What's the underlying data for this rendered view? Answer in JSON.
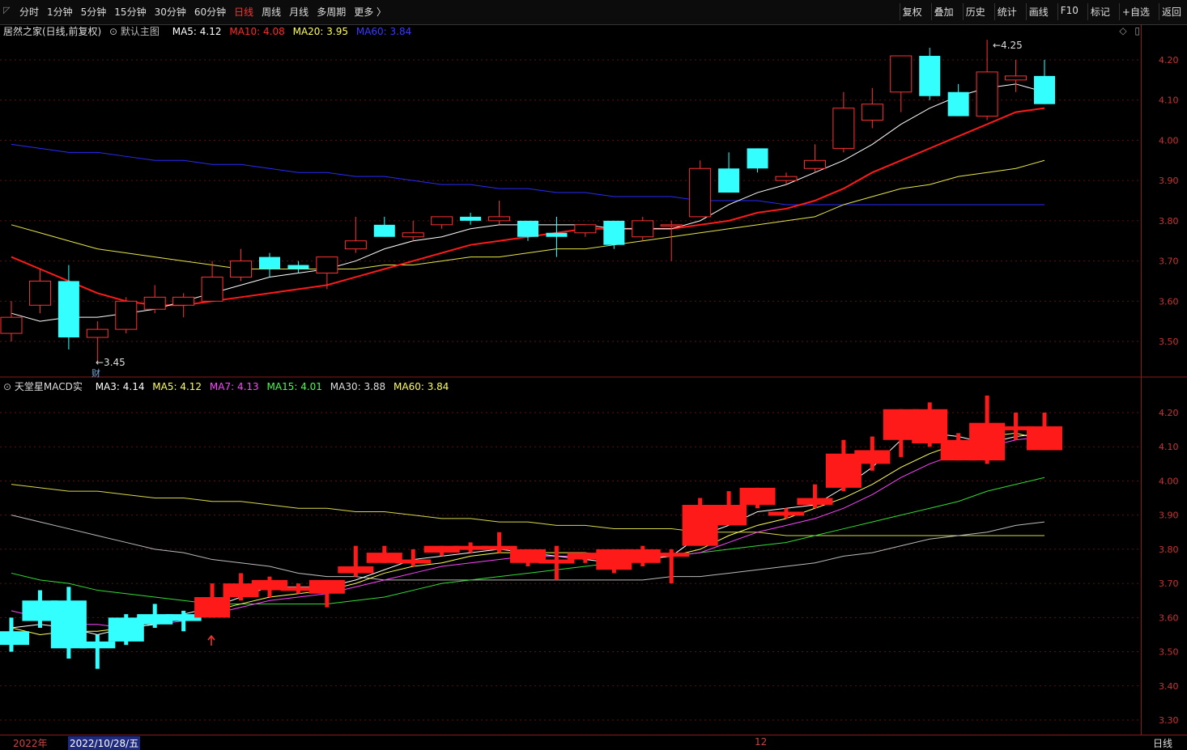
{
  "toolbar": {
    "periods": [
      "分时",
      "1分钟",
      "5分钟",
      "15分钟",
      "30分钟",
      "60分钟",
      "日线",
      "周线",
      "月线",
      "多周期",
      "更多 〉"
    ],
    "active_period": "日线",
    "tools": [
      "复权",
      "叠加",
      "历史",
      "统计",
      "画线",
      "F10",
      "标记",
      "+自选",
      "返回"
    ]
  },
  "main_panel": {
    "title": "居然之家(日线,前复权)",
    "indicator": "默认主图",
    "ma": [
      {
        "label": "MA5: 4.12",
        "color": "#ffffff"
      },
      {
        "label": "MA10: 4.08",
        "color": "#ff2a2a"
      },
      {
        "label": "MA20: 3.95",
        "color": "#ffff55"
      },
      {
        "label": "MA60: 3.84",
        "color": "#3a3aff"
      }
    ],
    "y_ticks": [
      "4.20",
      "4.10",
      "4.00",
      "3.90",
      "3.80",
      "3.70",
      "3.60",
      "3.50"
    ],
    "high_label": "4.25",
    "low_label": "3.45",
    "finance_mark": "财"
  },
  "sub_panel": {
    "title": "天堂星MACD实",
    "ma": [
      {
        "label": "MA3: 4.14",
        "color": "#ffffff"
      },
      {
        "label": "MA5: 4.12",
        "color": "#ffff55"
      },
      {
        "label": "MA7: 4.13",
        "color": "#ff44ff"
      },
      {
        "label": "MA15: 4.01",
        "color": "#44ff44"
      },
      {
        "label": "MA30: 3.88",
        "color": "#dddddd"
      },
      {
        "label": "MA60: 3.84",
        "color": "#ffff55"
      }
    ],
    "y_ticks": [
      "4.20",
      "4.10",
      "4.00",
      "3.90",
      "3.80",
      "3.70",
      "3.60",
      "3.50",
      "3.40",
      "3.30"
    ]
  },
  "bottom_bar": {
    "year": "2022年",
    "selected_date": "2022/10/28/五",
    "month_mark": "12",
    "period_label": "日线"
  },
  "chart_data": {
    "type": "candlestick",
    "candles": [
      {
        "o": 3.52,
        "c": 3.56,
        "h": 3.6,
        "l": 3.5
      },
      {
        "o": 3.59,
        "c": 3.65,
        "h": 3.68,
        "l": 3.57
      },
      {
        "o": 3.65,
        "c": 3.51,
        "h": 3.69,
        "l": 3.48
      },
      {
        "o": 3.51,
        "c": 3.53,
        "h": 3.55,
        "l": 3.45
      },
      {
        "o": 3.53,
        "c": 3.6,
        "h": 3.61,
        "l": 3.52
      },
      {
        "o": 3.58,
        "c": 3.61,
        "h": 3.64,
        "l": 3.57
      },
      {
        "o": 3.59,
        "c": 3.61,
        "h": 3.62,
        "l": 3.56
      },
      {
        "o": 3.6,
        "c": 3.66,
        "h": 3.7,
        "l": 3.6
      },
      {
        "o": 3.66,
        "c": 3.7,
        "h": 3.73,
        "l": 3.65
      },
      {
        "o": 3.71,
        "c": 3.68,
        "h": 3.72,
        "l": 3.66
      },
      {
        "o": 3.69,
        "c": 3.68,
        "h": 3.7,
        "l": 3.67
      },
      {
        "o": 3.67,
        "c": 3.71,
        "h": 3.71,
        "l": 3.63
      },
      {
        "o": 3.73,
        "c": 3.75,
        "h": 3.81,
        "l": 3.72
      },
      {
        "o": 3.79,
        "c": 3.76,
        "h": 3.81,
        "l": 3.76
      },
      {
        "o": 3.76,
        "c": 3.77,
        "h": 3.8,
        "l": 3.75
      },
      {
        "o": 3.79,
        "c": 3.81,
        "h": 3.81,
        "l": 3.78
      },
      {
        "o": 3.81,
        "c": 3.8,
        "h": 3.82,
        "l": 3.79
      },
      {
        "o": 3.8,
        "c": 3.81,
        "h": 3.85,
        "l": 3.79
      },
      {
        "o": 3.8,
        "c": 3.76,
        "h": 3.8,
        "l": 3.75
      },
      {
        "o": 3.77,
        "c": 3.76,
        "h": 3.81,
        "l": 3.71
      },
      {
        "o": 3.77,
        "c": 3.79,
        "h": 3.79,
        "l": 3.76
      },
      {
        "o": 3.8,
        "c": 3.74,
        "h": 3.8,
        "l": 3.73
      },
      {
        "o": 3.76,
        "c": 3.8,
        "h": 3.81,
        "l": 3.75
      },
      {
        "o": 3.79,
        "c": 3.79,
        "h": 3.8,
        "l": 3.7
      },
      {
        "o": 3.81,
        "c": 3.93,
        "h": 3.95,
        "l": 3.81
      },
      {
        "o": 3.93,
        "c": 3.87,
        "h": 3.97,
        "l": 3.87
      },
      {
        "o": 3.98,
        "c": 3.93,
        "h": 3.98,
        "l": 3.92
      },
      {
        "o": 3.9,
        "c": 3.91,
        "h": 3.92,
        "l": 3.89
      },
      {
        "o": 3.93,
        "c": 3.95,
        "h": 3.99,
        "l": 3.92
      },
      {
        "o": 3.98,
        "c": 4.08,
        "h": 4.12,
        "l": 3.97
      },
      {
        "o": 4.05,
        "c": 4.09,
        "h": 4.13,
        "l": 4.03
      },
      {
        "o": 4.12,
        "c": 4.21,
        "h": 4.21,
        "l": 4.07
      },
      {
        "o": 4.21,
        "c": 4.11,
        "h": 4.23,
        "l": 4.1
      },
      {
        "o": 4.12,
        "c": 4.06,
        "h": 4.14,
        "l": 4.06
      },
      {
        "o": 4.06,
        "c": 4.17,
        "h": 4.25,
        "l": 4.05
      },
      {
        "o": 4.15,
        "c": 4.16,
        "h": 4.2,
        "l": 4.12
      },
      {
        "o": 4.16,
        "c": 4.09,
        "h": 4.2,
        "l": 4.09
      }
    ],
    "ma_main": {
      "MA5": [
        3.57,
        3.55,
        3.56,
        3.56,
        3.57,
        3.58,
        3.6,
        3.62,
        3.64,
        3.66,
        3.67,
        3.68,
        3.7,
        3.73,
        3.75,
        3.76,
        3.78,
        3.79,
        3.79,
        3.79,
        3.79,
        3.78,
        3.78,
        3.78,
        3.8,
        3.84,
        3.87,
        3.89,
        3.92,
        3.95,
        3.99,
        4.04,
        4.08,
        4.11,
        4.13,
        4.14,
        4.12
      ],
      "MA10": [
        3.71,
        3.68,
        3.65,
        3.62,
        3.6,
        3.59,
        3.59,
        3.6,
        3.61,
        3.62,
        3.63,
        3.64,
        3.66,
        3.68,
        3.7,
        3.72,
        3.74,
        3.75,
        3.76,
        3.77,
        3.78,
        3.78,
        3.78,
        3.78,
        3.79,
        3.8,
        3.82,
        3.83,
        3.85,
        3.88,
        3.92,
        3.95,
        3.98,
        4.01,
        4.04,
        4.07,
        4.08
      ],
      "MA20": [
        3.79,
        3.77,
        3.75,
        3.73,
        3.72,
        3.71,
        3.7,
        3.69,
        3.68,
        3.68,
        3.68,
        3.68,
        3.68,
        3.69,
        3.69,
        3.7,
        3.71,
        3.71,
        3.72,
        3.73,
        3.73,
        3.74,
        3.75,
        3.76,
        3.77,
        3.78,
        3.79,
        3.8,
        3.81,
        3.84,
        3.86,
        3.88,
        3.89,
        3.91,
        3.92,
        3.93,
        3.95
      ],
      "MA60": [
        3.99,
        3.98,
        3.97,
        3.97,
        3.96,
        3.95,
        3.95,
        3.94,
        3.94,
        3.93,
        3.92,
        3.92,
        3.91,
        3.91,
        3.9,
        3.89,
        3.89,
        3.88,
        3.88,
        3.87,
        3.87,
        3.86,
        3.86,
        3.86,
        3.85,
        3.85,
        3.85,
        3.84,
        3.84,
        3.84,
        3.84,
        3.84,
        3.84,
        3.84,
        3.84,
        3.84,
        3.84
      ]
    },
    "ma_sub": {
      "MA3": [
        3.57,
        3.58,
        3.57,
        3.55,
        3.57,
        3.58,
        3.61,
        3.63,
        3.66,
        3.69,
        3.69,
        3.69,
        3.71,
        3.74,
        3.77,
        3.78,
        3.79,
        3.8,
        3.79,
        3.78,
        3.77,
        3.76,
        3.77,
        3.78,
        3.84,
        3.87,
        3.91,
        3.92,
        3.93,
        3.98,
        4.04,
        4.12,
        4.14,
        4.13,
        4.11,
        4.13,
        4.14
      ],
      "MA5": [
        3.57,
        3.55,
        3.56,
        3.56,
        3.57,
        3.58,
        3.6,
        3.62,
        3.64,
        3.66,
        3.67,
        3.68,
        3.7,
        3.73,
        3.75,
        3.76,
        3.78,
        3.79,
        3.79,
        3.79,
        3.79,
        3.78,
        3.78,
        3.78,
        3.8,
        3.84,
        3.87,
        3.89,
        3.92,
        3.95,
        3.99,
        4.04,
        4.08,
        4.11,
        4.13,
        4.14,
        4.12
      ],
      "MA7": [
        3.62,
        3.6,
        3.58,
        3.58,
        3.57,
        3.58,
        3.59,
        3.61,
        3.63,
        3.65,
        3.66,
        3.67,
        3.69,
        3.71,
        3.73,
        3.75,
        3.76,
        3.77,
        3.78,
        3.78,
        3.78,
        3.78,
        3.78,
        3.78,
        3.79,
        3.82,
        3.85,
        3.87,
        3.89,
        3.92,
        3.96,
        4.01,
        4.05,
        4.08,
        4.1,
        4.12,
        4.13
      ],
      "MA15": [
        3.73,
        3.71,
        3.7,
        3.68,
        3.67,
        3.66,
        3.65,
        3.64,
        3.64,
        3.64,
        3.64,
        3.64,
        3.65,
        3.66,
        3.68,
        3.7,
        3.71,
        3.72,
        3.73,
        3.74,
        3.75,
        3.76,
        3.77,
        3.78,
        3.79,
        3.8,
        3.81,
        3.82,
        3.84,
        3.86,
        3.88,
        3.9,
        3.92,
        3.94,
        3.97,
        3.99,
        4.01
      ],
      "MA30": [
        3.9,
        3.88,
        3.86,
        3.84,
        3.82,
        3.8,
        3.79,
        3.77,
        3.76,
        3.75,
        3.73,
        3.72,
        3.72,
        3.71,
        3.71,
        3.71,
        3.71,
        3.71,
        3.71,
        3.71,
        3.71,
        3.71,
        3.71,
        3.72,
        3.72,
        3.73,
        3.74,
        3.75,
        3.76,
        3.78,
        3.79,
        3.81,
        3.83,
        3.84,
        3.85,
        3.87,
        3.88
      ],
      "MA60": [
        3.99,
        3.98,
        3.97,
        3.97,
        3.96,
        3.95,
        3.95,
        3.94,
        3.94,
        3.93,
        3.92,
        3.92,
        3.91,
        3.91,
        3.9,
        3.89,
        3.89,
        3.88,
        3.88,
        3.87,
        3.87,
        3.86,
        3.86,
        3.86,
        3.85,
        3.85,
        3.85,
        3.84,
        3.84,
        3.84,
        3.84,
        3.84,
        3.84,
        3.84,
        3.84,
        3.84,
        3.84
      ]
    },
    "main_ylim": [
      3.42,
      4.26
    ],
    "sub_ylim": [
      3.28,
      4.25
    ]
  }
}
